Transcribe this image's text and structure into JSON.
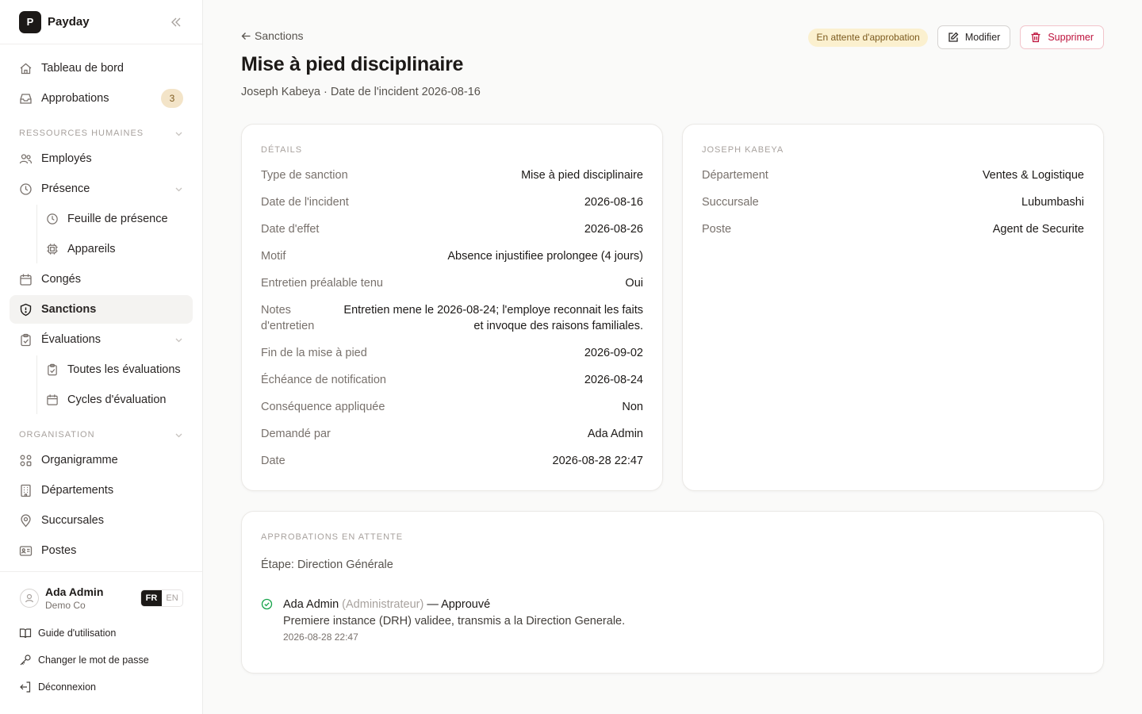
{
  "app": {
    "logo_letter": "P",
    "name": "Payday"
  },
  "nav": {
    "dashboard": "Tableau de bord",
    "approvals": "Approbations",
    "approvals_count": "3",
    "hr_section": "RESSOURCES HUMAINES",
    "employees": "Employés",
    "presence": "Présence",
    "timesheet": "Feuille de présence",
    "devices": "Appareils",
    "leave": "Congés",
    "sanctions": "Sanctions",
    "evaluations": "Évaluations",
    "all_evaluations": "Toutes les évaluations",
    "evaluation_cycles": "Cycles d'évaluation",
    "org_section": "ORGANISATION",
    "orgchart": "Organigramme",
    "departments": "Départements",
    "branches": "Succursales",
    "positions": "Postes"
  },
  "user": {
    "name": "Ada Admin",
    "org": "Demo Co",
    "lang_active": "FR",
    "lang_other": "EN"
  },
  "footer": {
    "guide": "Guide d'utilisation",
    "change_password": "Changer le mot de passe",
    "logout": "Déconnexion"
  },
  "page": {
    "back_label": "Sanctions",
    "title": "Mise à pied disciplinaire",
    "subtitle": "Joseph Kabeya · Date de l'incident 2026-08-16",
    "status": "En attente d'approbation",
    "edit_label": "Modifier",
    "delete_label": "Supprimer"
  },
  "details": {
    "title": "DÉTAILS",
    "rows": [
      {
        "label": "Type de sanction",
        "value": "Mise à pied disciplinaire"
      },
      {
        "label": "Date de l'incident",
        "value": "2026-08-16"
      },
      {
        "label": "Date d'effet",
        "value": "2026-08-26"
      },
      {
        "label": "Motif",
        "value": "Absence injustifiee prolongee (4 jours)"
      },
      {
        "label": "Entretien préalable tenu",
        "value": "Oui"
      },
      {
        "label": "Notes d'entretien",
        "value": "Entretien mene le 2026-08-24; l'employe reconnait les faits et invoque des raisons familiales."
      },
      {
        "label": "Fin de la mise à pied",
        "value": "2026-09-02"
      },
      {
        "label": "Échéance de notification",
        "value": "2026-08-24"
      },
      {
        "label": "Conséquence appliquée",
        "value": "Non"
      },
      {
        "label": "Demandé par",
        "value": "Ada Admin"
      },
      {
        "label": "Date",
        "value": "2026-08-28 22:47"
      }
    ]
  },
  "employee": {
    "title": "JOSEPH KABEYA",
    "rows": [
      {
        "label": "Département",
        "value": "Ventes & Logistique"
      },
      {
        "label": "Succursale",
        "value": "Lubumbashi"
      },
      {
        "label": "Poste",
        "value": "Agent de Securite"
      }
    ]
  },
  "approvals": {
    "title": "APPROBATIONS EN ATTENTE",
    "stage": "Étape: Direction Générale",
    "entry": {
      "name": "Ada Admin",
      "role": "(Administrateur)",
      "decision": "— Approuvé",
      "comment": "Premiere instance (DRH) validee, transmis a la Direction Generale.",
      "date": "2026-08-28 22:47"
    }
  },
  "colors": {
    "status_bg": "#fbf0cf",
    "status_text": "#7c5a1e",
    "danger": "#be123c",
    "success": "#16a34a"
  }
}
